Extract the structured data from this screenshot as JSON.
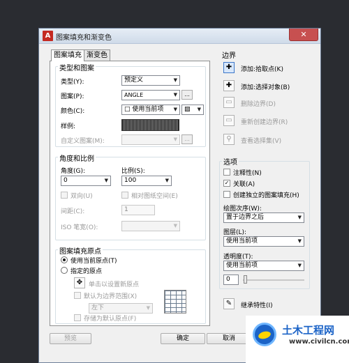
{
  "window": {
    "title": "图案填充和渐变色",
    "close_glyph": "✕",
    "app_glyph": "A"
  },
  "tabs": [
    {
      "label": "图案填充",
      "active": true
    },
    {
      "label": "渐变色",
      "active": false
    }
  ],
  "type_pattern": {
    "title": "类型和图案",
    "type_label": "类型(Y):",
    "type_value": "预定义",
    "pattern_label": "图案(P):",
    "pattern_value": "ANGLE",
    "pattern_btn": "...",
    "color_label": "颜色(C):",
    "color_value": "□ 使用当前项",
    "color_bg_value": "▨",
    "sample_label": "样例:",
    "custom_label": "自定义图案(M):",
    "custom_btn": "..."
  },
  "angle_scale": {
    "title": "角度和比例",
    "angle_label": "角度(G):",
    "angle_value": "0",
    "scale_label": "比例(S):",
    "scale_value": "100",
    "double_label": "双向(U)",
    "relative_label": "相对图纸空间(E)",
    "spacing_label": "间距(C):",
    "spacing_value": "1",
    "iso_label": "ISO 笔宽(O):"
  },
  "origin": {
    "title": "图案填充原点",
    "use_current": "使用当前原点(T)",
    "specified": "指定的原点",
    "click_set": "单击以设置新原点",
    "default_boundary": "默认为边界范围(X)",
    "position_value": "左下",
    "store_default": "存储为默认原点(F)"
  },
  "boundary": {
    "title": "边界",
    "add_pick": "添加:拾取点(K)",
    "add_select": "添加:选择对象(B)",
    "remove": "删除边界(D)",
    "recreate": "重新创建边界(R)",
    "view": "查看选择集(V)"
  },
  "options": {
    "title": "选项",
    "annotative": "注释性(N)",
    "annotative_checked": false,
    "associative": "关联(A)",
    "associative_checked": true,
    "independent": "创建独立的图案填充(H)",
    "independent_checked": false,
    "draw_order_label": "绘图次序(W):",
    "draw_order_value": "置于边界之后",
    "layer_label": "图层(L):",
    "layer_value": "使用当前项",
    "transparency_label": "透明度(T):",
    "transparency_value": "使用当前项",
    "transparency_number": "0"
  },
  "inherit": "继承特性(I)",
  "footer": {
    "preview": "预览",
    "ok": "确定",
    "cancel": "取消"
  },
  "watermark": {
    "brand": "土木工程网",
    "url": "www.civilcn.com"
  }
}
